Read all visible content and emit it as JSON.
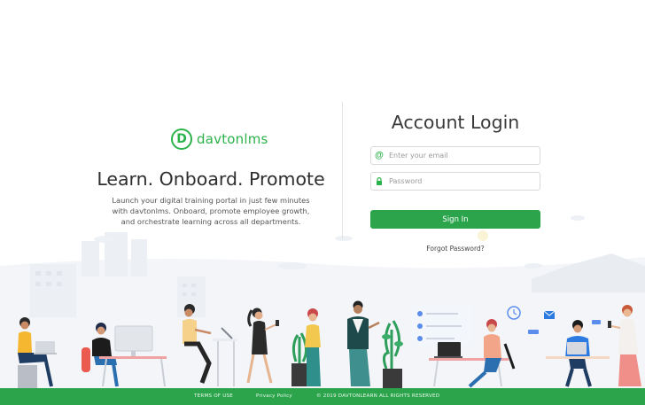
{
  "brand": {
    "logo_letter": "D",
    "name": "davtonlms",
    "color": "#2bb34b"
  },
  "hero": {
    "tagline": "Learn. Onboard. Promote",
    "description": "Launch your digital training portal in just few minutes with davtonlms.  Onboard, promote employee growth, and orchestrate learning across all departments."
  },
  "login": {
    "title": "Account Login",
    "email_icon": "at-icon",
    "email_icon_glyph": "@",
    "email_placeholder": "Enter your email",
    "email_value": "",
    "password_icon": "lock-icon",
    "password_placeholder": "Password",
    "password_value": "",
    "signin_label": "Sign In",
    "forgot_label": "Forgot Password?",
    "button_color": "#2ba44c"
  },
  "footer": {
    "terms": "TERMS OF USE",
    "privacy": "Privacy Policy",
    "copyright": "© 2019 DAVTONLEARN ALL RIGHTS RESERVED"
  },
  "illustration": {
    "subject": "office-team-illustration",
    "accent": "#2ba44c"
  }
}
